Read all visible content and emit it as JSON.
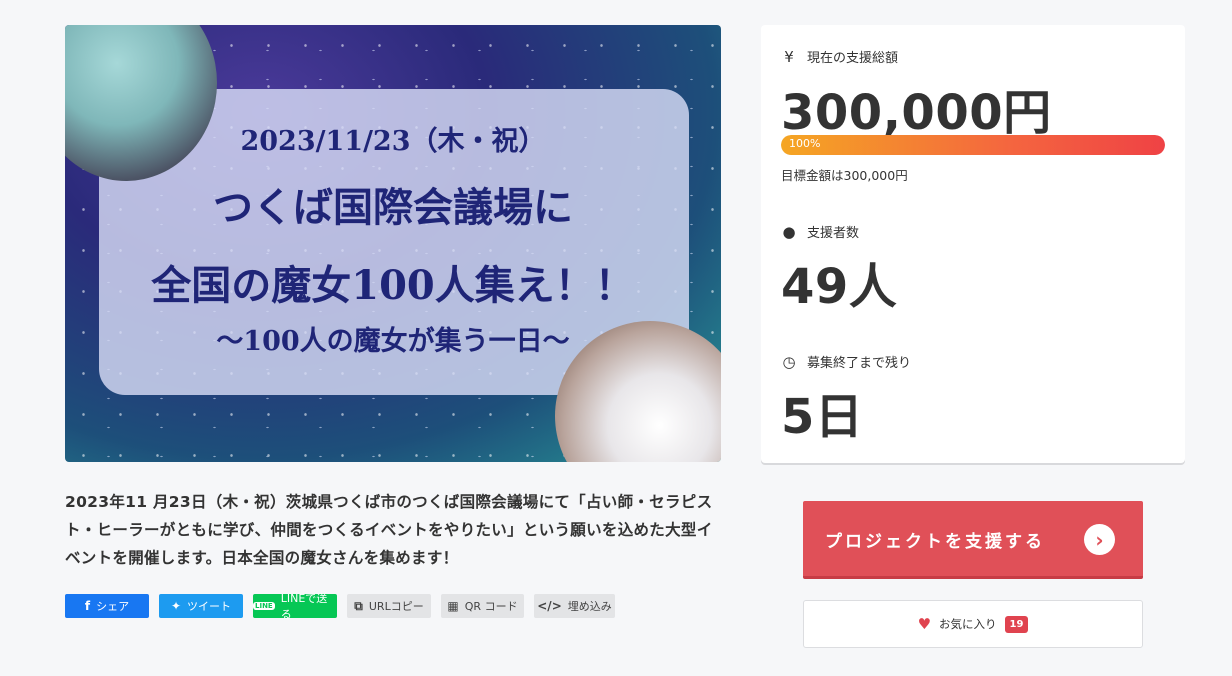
{
  "hero": {
    "date_line": "2023/11/23（木・祝）",
    "title_line1": "つくば国際会議場に",
    "title_line2": "全国の魔女100人集え！！",
    "subtitle": "〜100人の魔女が集う一日〜"
  },
  "description": "2023年11 月23日（木・祝）茨城県つくば市のつくば国際会議場にて「占い師・セラピスト・ヒーラーがともに学び、仲間をつくるイベントをやりたい」という願いを込めた大型イベントを開催します。日本全国の魔女さんを集めます！",
  "share": {
    "facebook": "シェア",
    "twitter": "ツイート",
    "line": "LINEで送る",
    "url_copy": "URLコピー",
    "qr": "QR コード",
    "embed": "埋め込み"
  },
  "stats": {
    "amount_label": "現在の支援総額",
    "amount_value": "300,000円",
    "progress_percent": 100,
    "progress_text": "100%",
    "goal_text": "目標金額は300,000円",
    "supporters_label": "支援者数",
    "supporters_value": "49人",
    "remaining_label": "募集終了まで残り",
    "remaining_value": "5日"
  },
  "actions": {
    "support_label": "プロジェクトを支援する",
    "favorite_label": "お気に入り",
    "favorite_count": "19"
  },
  "colors": {
    "support_button": "#e05058",
    "progress_start": "#f5a623",
    "progress_end": "#ef4245",
    "facebook": "#1877f2",
    "twitter": "#1d9bf0",
    "line": "#06c755"
  }
}
